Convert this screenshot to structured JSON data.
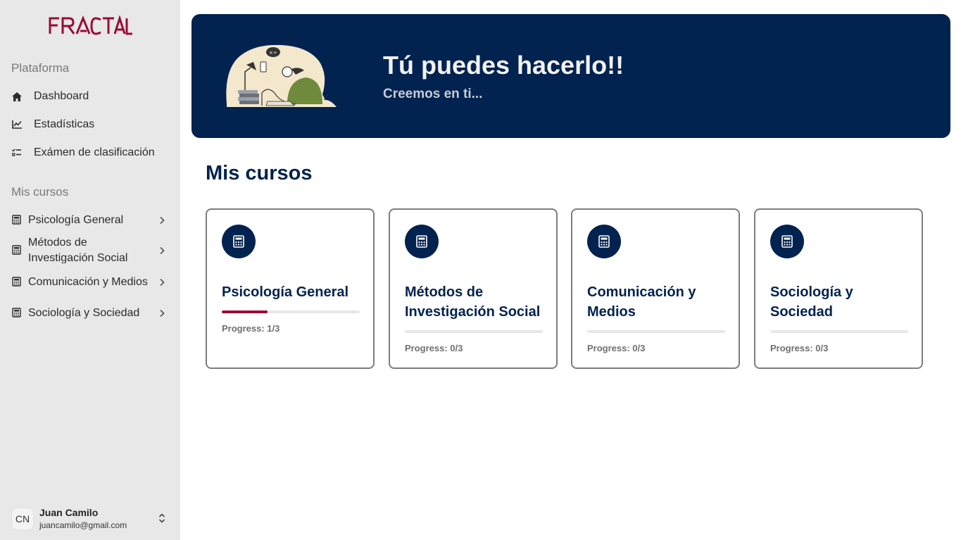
{
  "brand": {
    "logo_text": "FRACTAL",
    "logo_color": "#9b0c35"
  },
  "sidebar": {
    "platform_label": "Plataforma",
    "nav": [
      {
        "label": "Dashboard",
        "icon": "home-icon"
      },
      {
        "label": "Estadísticas",
        "icon": "chart-line-icon"
      },
      {
        "label": "Exámen de clasificación",
        "icon": "checklist-icon"
      }
    ],
    "courses_label": "Mis cursos",
    "courses": [
      {
        "label": "Psicología General",
        "icon": "calculator-icon"
      },
      {
        "label": "Métodos de Investigación Social",
        "icon": "calculator-icon"
      },
      {
        "label": "Comunicación y Medios",
        "icon": "calculator-icon"
      },
      {
        "label": "Sociología y Sociedad",
        "icon": "calculator-icon"
      }
    ],
    "user": {
      "initials": "CN",
      "name": "Juan Camilo",
      "email": "juancamilo@gmail.com"
    }
  },
  "banner": {
    "title": "Tú puedes hacerlo!!",
    "subtitle": "Creemos en ti...",
    "background": "#02224f"
  },
  "main": {
    "section_title": "Mis cursos",
    "cards": [
      {
        "title": "Psicología General",
        "progress_text": "Progress: 1/3",
        "progress_fraction": 0.333
      },
      {
        "title": "Métodos de Investigación Social",
        "progress_text": "Progress: 0/3",
        "progress_fraction": 0
      },
      {
        "title": "Comunicación y Medios",
        "progress_text": "Progress: 0/3",
        "progress_fraction": 0
      },
      {
        "title": "Sociología y Sociedad",
        "progress_text": "Progress: 0/3",
        "progress_fraction": 0
      }
    ]
  },
  "colors": {
    "accent": "#9b0c35",
    "navy": "#02224f",
    "sidebar_bg": "#e8e8e8"
  }
}
